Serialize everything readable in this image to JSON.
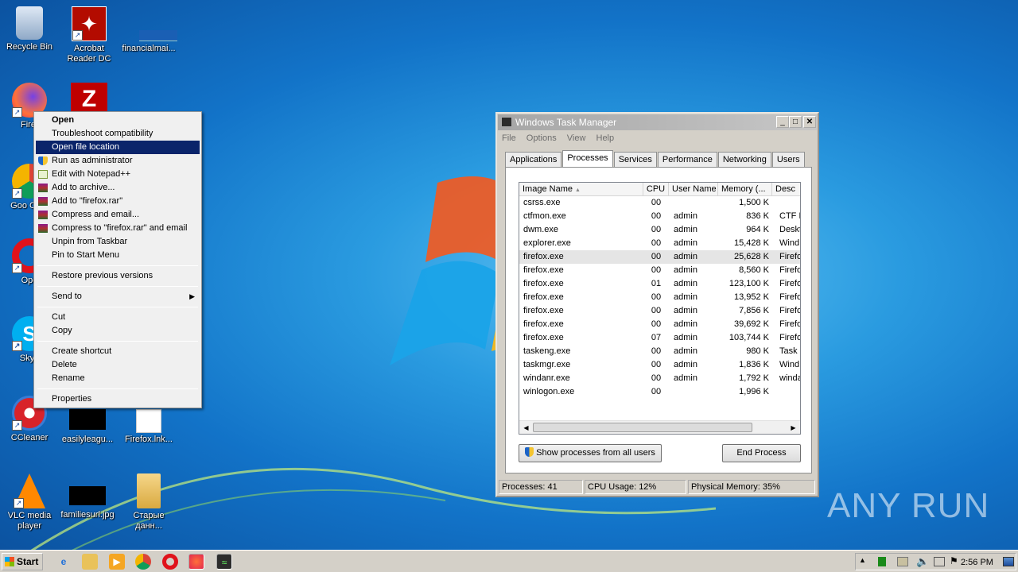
{
  "desktop_icons": [
    {
      "label": "Recycle Bin",
      "icon": "recycle-bin-icon"
    },
    {
      "label": "Acrobat Reader DC",
      "icon": "acrobat-icon"
    },
    {
      "label": "financialmai...",
      "icon": "document-icon"
    },
    {
      "label": "Firef",
      "icon": "firefox-icon"
    },
    {
      "label": "",
      "icon": "filezilla-icon"
    },
    {
      "label": "Goo Chro",
      "icon": "chrome-icon"
    },
    {
      "label": "Ope",
      "icon": "opera-icon"
    },
    {
      "label": "Skyp",
      "icon": "skype-icon"
    },
    {
      "label": "CCleaner",
      "icon": "ccleaner-icon"
    },
    {
      "label": "easilyleagu...",
      "icon": "image-file-icon"
    },
    {
      "label": "Firefox.lnk...",
      "icon": "blank-file-icon"
    },
    {
      "label": "VLC media player",
      "icon": "vlc-icon"
    },
    {
      "label": "familiesurl.jpg",
      "icon": "image-file-icon"
    },
    {
      "label": "Старые данн...",
      "icon": "folder-icon"
    }
  ],
  "context_menu": {
    "items": [
      {
        "label": "Open",
        "bold": true
      },
      {
        "label": "Troubleshoot compatibility"
      },
      {
        "label": "Open file location",
        "highlighted": true
      },
      {
        "label": "Run as administrator",
        "icon": "shield-icon"
      },
      {
        "label": "Edit with Notepad++",
        "icon": "notepadpp-icon"
      },
      {
        "label": "Add to archive...",
        "icon": "winrar-icon"
      },
      {
        "label": "Add to \"firefox.rar\"",
        "icon": "winrar-icon"
      },
      {
        "label": "Compress and email...",
        "icon": "winrar-icon"
      },
      {
        "label": "Compress to \"firefox.rar\" and email",
        "icon": "winrar-icon"
      },
      {
        "label": "Unpin from Taskbar"
      },
      {
        "label": "Pin to Start Menu"
      },
      {
        "label": "Restore previous versions"
      },
      {
        "label": "Send to"
      },
      {
        "label": "Cut"
      },
      {
        "label": "Copy"
      },
      {
        "label": "Create shortcut"
      },
      {
        "label": "Delete"
      },
      {
        "label": "Rename"
      },
      {
        "label": "Properties"
      }
    ]
  },
  "task_manager": {
    "title": "Windows Task Manager",
    "menu": [
      "File",
      "Options",
      "View",
      "Help"
    ],
    "tabs": [
      "Applications",
      "Processes",
      "Services",
      "Performance",
      "Networking",
      "Users"
    ],
    "active_tab": "Processes",
    "columns": [
      "Image Name",
      "CPU",
      "User Name",
      "Memory (...",
      "Desc"
    ],
    "rows": [
      {
        "name": "csrss.exe",
        "cpu": "00",
        "user": "",
        "mem": "1,500 K",
        "desc": ""
      },
      {
        "name": "ctfmon.exe",
        "cpu": "00",
        "user": "admin",
        "mem": "836 K",
        "desc": "CTF L"
      },
      {
        "name": "dwm.exe",
        "cpu": "00",
        "user": "admin",
        "mem": "964 K",
        "desc": "Deskt"
      },
      {
        "name": "explorer.exe",
        "cpu": "00",
        "user": "admin",
        "mem": "15,428 K",
        "desc": "Wind"
      },
      {
        "name": "firefox.exe",
        "cpu": "00",
        "user": "admin",
        "mem": "25,628 K",
        "desc": "Firefo"
      },
      {
        "name": "firefox.exe",
        "cpu": "00",
        "user": "admin",
        "mem": "8,560 K",
        "desc": "Firefo"
      },
      {
        "name": "firefox.exe",
        "cpu": "01",
        "user": "admin",
        "mem": "123,100 K",
        "desc": "Firefo"
      },
      {
        "name": "firefox.exe",
        "cpu": "00",
        "user": "admin",
        "mem": "13,952 K",
        "desc": "Firefo"
      },
      {
        "name": "firefox.exe",
        "cpu": "00",
        "user": "admin",
        "mem": "7,856 K",
        "desc": "Firefo"
      },
      {
        "name": "firefox.exe",
        "cpu": "00",
        "user": "admin",
        "mem": "39,692 K",
        "desc": "Firefo"
      },
      {
        "name": "firefox.exe",
        "cpu": "07",
        "user": "admin",
        "mem": "103,744 K",
        "desc": "Firefo"
      },
      {
        "name": "taskeng.exe",
        "cpu": "00",
        "user": "admin",
        "mem": "980 K",
        "desc": "Task"
      },
      {
        "name": "taskmgr.exe",
        "cpu": "00",
        "user": "admin",
        "mem": "1,836 K",
        "desc": "Wind"
      },
      {
        "name": "windanr.exe",
        "cpu": "00",
        "user": "admin",
        "mem": "1,792 K",
        "desc": "winda"
      },
      {
        "name": "winlogon.exe",
        "cpu": "00",
        "user": "",
        "mem": "1,996 K",
        "desc": ""
      }
    ],
    "show_all_label": "Show processes from all users",
    "end_process_label": "End Process",
    "status": {
      "processes": "Processes: 41",
      "cpu": "CPU Usage: 12%",
      "memory": "Physical Memory: 35%"
    }
  },
  "taskbar": {
    "start_label": "Start",
    "pinned": [
      "ie-icon",
      "explorer-icon",
      "media-player-icon",
      "chrome-icon",
      "opera-icon",
      "firefox-icon",
      "taskmgr-icon"
    ],
    "clock": "2:56 PM"
  },
  "watermark": "ANY RUN"
}
